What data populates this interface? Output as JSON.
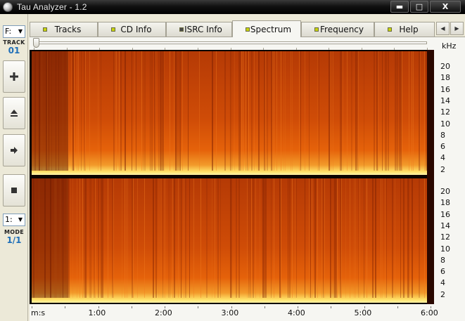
{
  "window": {
    "title": "Tau Analyzer - 1.2",
    "minimize_glyph": "▬",
    "maximize_glyph": "□",
    "close_glyph": "X"
  },
  "left_panel": {
    "drive_value": "F:",
    "track_label": "TRACK",
    "track_value": "01",
    "mode_select_value": "1:",
    "mode_label": "MODE",
    "mode_value": "1/1",
    "buttons": [
      {
        "name": "add",
        "icon": "plus-icon"
      },
      {
        "name": "eject",
        "icon": "eject-icon"
      },
      {
        "name": "play",
        "icon": "play-icon"
      },
      {
        "name": "stop",
        "icon": "stop-icon"
      }
    ]
  },
  "tabs": [
    {
      "label": "Tracks",
      "led": "#c7d40e",
      "active": false
    },
    {
      "label": "CD Info",
      "led": "#c7d40e",
      "active": false
    },
    {
      "label": "ISRC Info",
      "led": "#4a4a4a",
      "active": false
    },
    {
      "label": "Spectrum",
      "led": "#c7d40e",
      "active": true
    },
    {
      "label": "Frequency",
      "led": "#c7d40e",
      "active": false
    },
    {
      "label": "Help",
      "led": "#c7d40e",
      "active": false
    }
  ],
  "tab_nav": {
    "left_glyph": "◀",
    "right_glyph": "▶"
  },
  "spectrum": {
    "frequency_unit": "kHz",
    "frequency_ticks": [
      "20",
      "18",
      "16",
      "14",
      "12",
      "10",
      "8",
      "6",
      "4",
      "2"
    ],
    "time_unit": "m:s",
    "time_ticks": [
      "1:00",
      "2:00",
      "3:00",
      "4:00",
      "5:00",
      "6:00"
    ],
    "channels": 2,
    "colors": {
      "background": "#0b0400",
      "low": "#ffe36a",
      "mid": "#e5620a",
      "high": "#b53a05",
      "edge": "#5a1402"
    },
    "slider_position": 0
  }
}
